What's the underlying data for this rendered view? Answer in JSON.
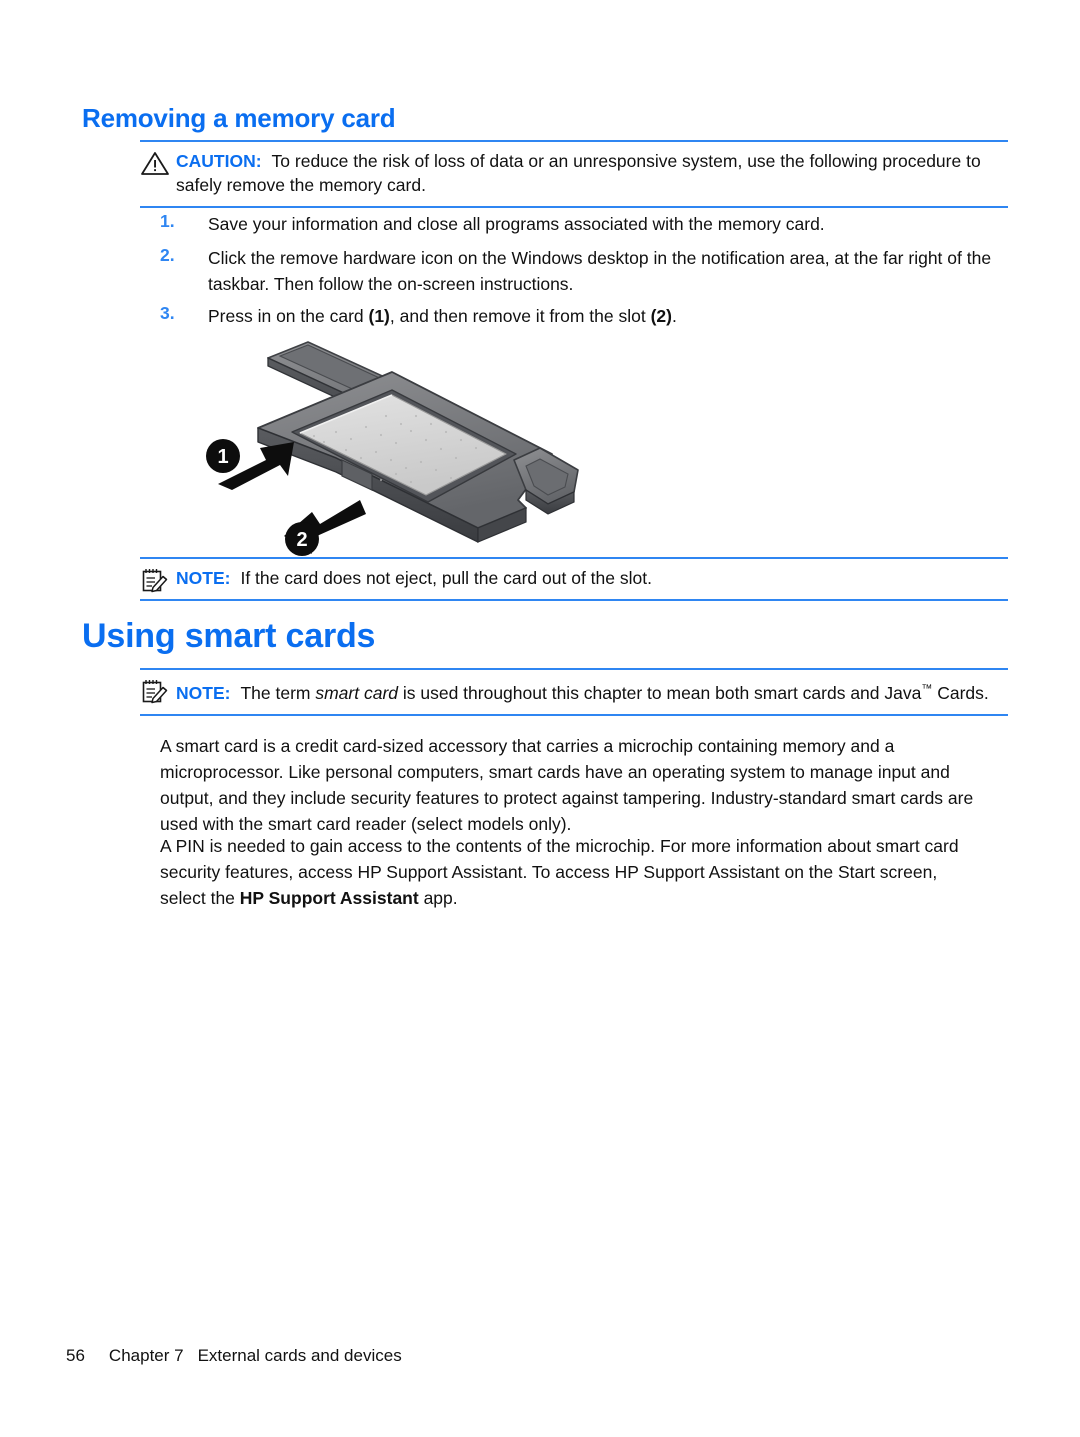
{
  "document": {
    "heading_removing": "Removing a memory card",
    "heading_using": "Using smart cards"
  },
  "caution": {
    "icon": "warning-triangle-icon",
    "label": "CAUTION:",
    "text": "To reduce the risk of loss of data or an unresponsive system, use the following procedure to safely remove the memory card."
  },
  "steps": [
    {
      "num": "1.",
      "text": "Save your information and close all programs associated with the memory card."
    },
    {
      "num": "2.",
      "text": "Click the remove hardware icon on the Windows desktop in the notification area, at the far right of the taskbar. Then follow the on-screen instructions."
    },
    {
      "num": "3.",
      "pre": "Press in on the card ",
      "ref1": "(1)",
      "mid": ", and then remove it from the slot ",
      "ref2": "(2)",
      "post": "."
    }
  ],
  "figure": {
    "name": "memory-card-slot-illustration",
    "callout_1": "1",
    "callout_2": "2",
    "alt": "Memory card being pressed in then removed from the card slot"
  },
  "note_eject": {
    "icon": "notepad-pencil-icon",
    "label": "NOTE:",
    "text": "If the card does not eject, pull the card out of the slot."
  },
  "note_smartcard": {
    "icon": "notepad-pencil-icon",
    "label": "NOTE:",
    "pre": "The term ",
    "italic": "smart card",
    "mid": " is used throughout this chapter to mean both smart cards and Java",
    "tm": "™",
    "post": " Cards."
  },
  "paragraphs": {
    "p1": "A smart card is a credit card-sized accessory that carries a microchip containing memory and a microprocessor. Like personal computers, smart cards have an operating system to manage input and output, and they include security features to protect against tampering. Industry-standard smart cards are used with the smart card reader (select models only).",
    "p2_pre": "A PIN is needed to gain access to the contents of the microchip. For more information about smart card security features, access HP Support Assistant. To access HP Support Assistant on the Start screen, select the ",
    "p2_bold": "HP Support Assistant",
    "p2_post": " app."
  },
  "footer": {
    "page_number": "56",
    "chapter": "Chapter 7",
    "title": "External cards and devices"
  },
  "colors": {
    "heading_blue": "#0a6ef0",
    "rule_blue": "#2f86f2",
    "body_black": "#111111"
  }
}
